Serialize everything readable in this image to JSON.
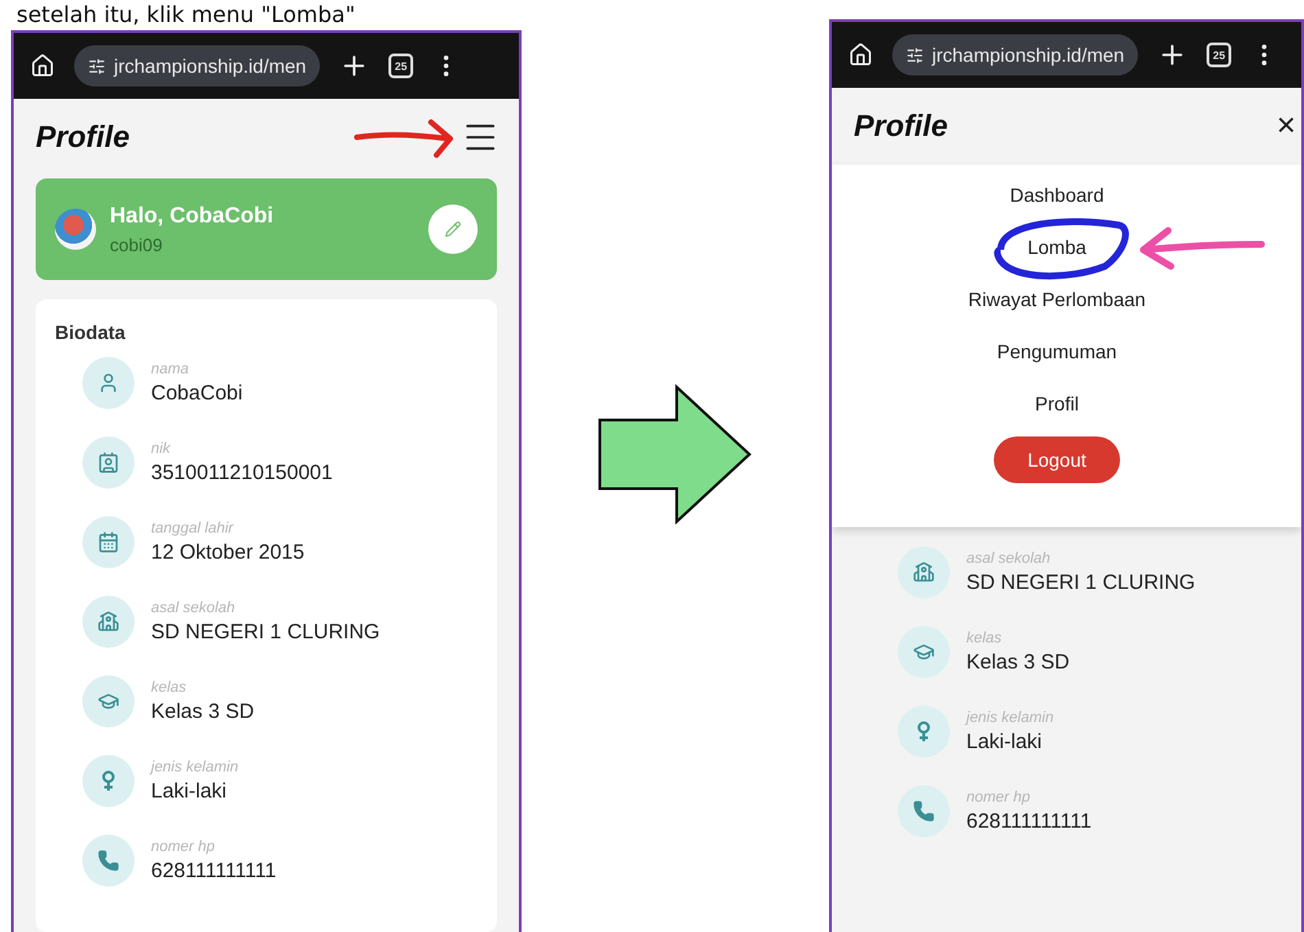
{
  "caption": "setelah itu, klik menu \"Lomba\"",
  "left_screen": {
    "browser": {
      "url": "jrchampionship.id/men",
      "tab_count": "25"
    },
    "header": {
      "title": "Profile"
    },
    "greeting": {
      "title": "Halo, CobaCobi",
      "username": "cobi09"
    },
    "biodata": {
      "title": "Biodata",
      "fields": [
        {
          "kind": "person",
          "label": "nama",
          "value": "CobaCobi"
        },
        {
          "kind": "id",
          "label": "nik",
          "value": "3510011210150001"
        },
        {
          "kind": "calendar",
          "label": "tanggal lahir",
          "value": "12 Oktober 2015"
        },
        {
          "kind": "school",
          "label": "asal sekolah",
          "value": "SD NEGERI 1 CLURING"
        },
        {
          "kind": "class",
          "label": "kelas",
          "value": "Kelas 3 SD"
        },
        {
          "kind": "gender",
          "label": "jenis kelamin",
          "value": "Laki-laki"
        },
        {
          "kind": "phone",
          "label": "nomer hp",
          "value": "628111111111"
        }
      ]
    }
  },
  "right_screen": {
    "browser": {
      "url": "jrchampionship.id/men",
      "tab_count": "25"
    },
    "header": {
      "title": "Profile",
      "close": "×"
    },
    "menu": {
      "items": [
        "Dashboard",
        "Lomba",
        "Riwayat Perlombaan",
        "Pengumuman",
        "Profil"
      ],
      "logout": "Logout"
    },
    "fields": [
      {
        "kind": "school",
        "label": "asal sekolah",
        "value": "SD NEGERI 1 CLURING"
      },
      {
        "kind": "class",
        "label": "kelas",
        "value": "Kelas 3 SD"
      },
      {
        "kind": "gender",
        "label": "jenis kelamin",
        "value": "Laki-laki"
      },
      {
        "kind": "phone",
        "label": "nomer hp",
        "value": "628111111111"
      }
    ]
  }
}
